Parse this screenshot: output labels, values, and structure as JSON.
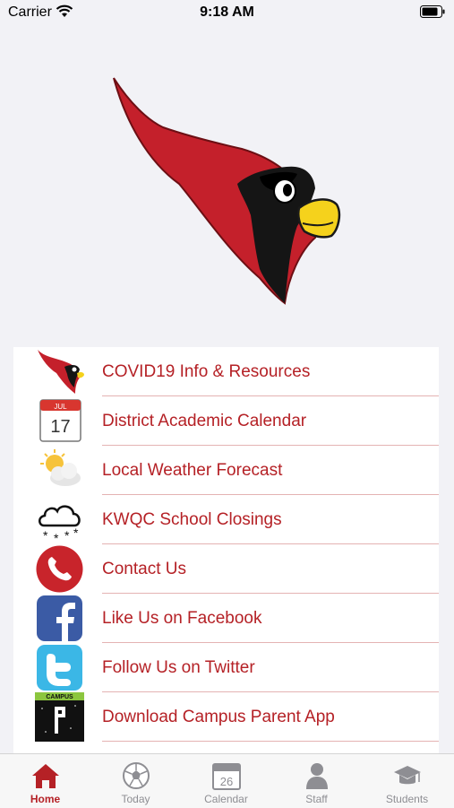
{
  "status_bar": {
    "carrier": "Carrier",
    "time": "9:18 AM"
  },
  "menu": {
    "items": [
      {
        "label": "COVID19 Info & Resources",
        "icon": "cardinal-icon"
      },
      {
        "label": "District Academic Calendar",
        "icon": "calendar-icon",
        "calendar_month": "JUL",
        "calendar_day": "17"
      },
      {
        "label": "Local Weather Forecast",
        "icon": "weather-icon"
      },
      {
        "label": "KWQC School Closings",
        "icon": "snow-cloud-icon"
      },
      {
        "label": "Contact Us",
        "icon": "phone-icon"
      },
      {
        "label": "Like Us on Facebook",
        "icon": "facebook-icon"
      },
      {
        "label": "Follow Us on Twitter",
        "icon": "twitter-icon"
      },
      {
        "label": "Download Campus Parent App",
        "icon": "campus-app-icon",
        "icon_text": "CAMPUS"
      }
    ]
  },
  "tabs": [
    {
      "label": "Home",
      "icon": "home-icon",
      "active": true
    },
    {
      "label": "Today",
      "icon": "soccer-ball-icon"
    },
    {
      "label": "Calendar",
      "icon": "calendar-tab-icon",
      "icon_text": "26"
    },
    {
      "label": "Staff",
      "icon": "person-icon"
    },
    {
      "label": "Students",
      "icon": "graduation-cap-icon"
    }
  ],
  "colors": {
    "accent": "#b52126",
    "background": "#f2f2f6",
    "tab_inactive": "#8e8e93"
  }
}
